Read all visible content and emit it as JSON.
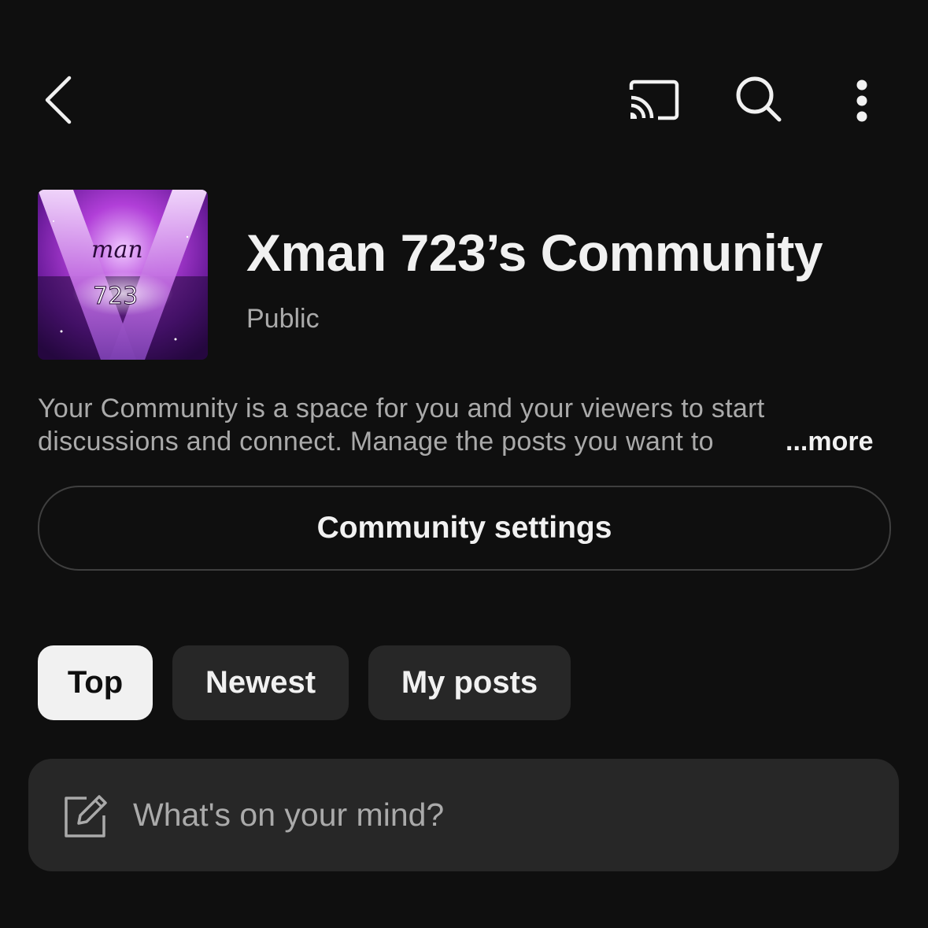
{
  "header": {
    "back_icon": "chevron-left-icon",
    "cast_icon": "cast-icon",
    "search_icon": "search-icon",
    "more_icon": "more-vertical-icon"
  },
  "community": {
    "avatar_text_top": "man",
    "avatar_text_bottom": "723",
    "title": "Xman 723’s Community",
    "visibility": "Public",
    "description_line1": "Your Community is a space for you and your viewers to start",
    "description_line2": "discussions and connect. Manage the posts you want to",
    "more_label": "...more"
  },
  "settings_button": {
    "label": "Community settings"
  },
  "filters": [
    {
      "label": "Top",
      "active": true
    },
    {
      "label": "Newest",
      "active": false
    },
    {
      "label": "My posts",
      "active": false
    }
  ],
  "composer": {
    "icon": "edit-icon",
    "placeholder": "What's on your mind?"
  },
  "colors": {
    "background": "#0f0f0f",
    "text_primary": "#f1f1f1",
    "text_secondary": "#aaaaaa",
    "chip_inactive": "#272727",
    "chip_active": "#f1f1f1",
    "border": "#3f3f3f"
  }
}
